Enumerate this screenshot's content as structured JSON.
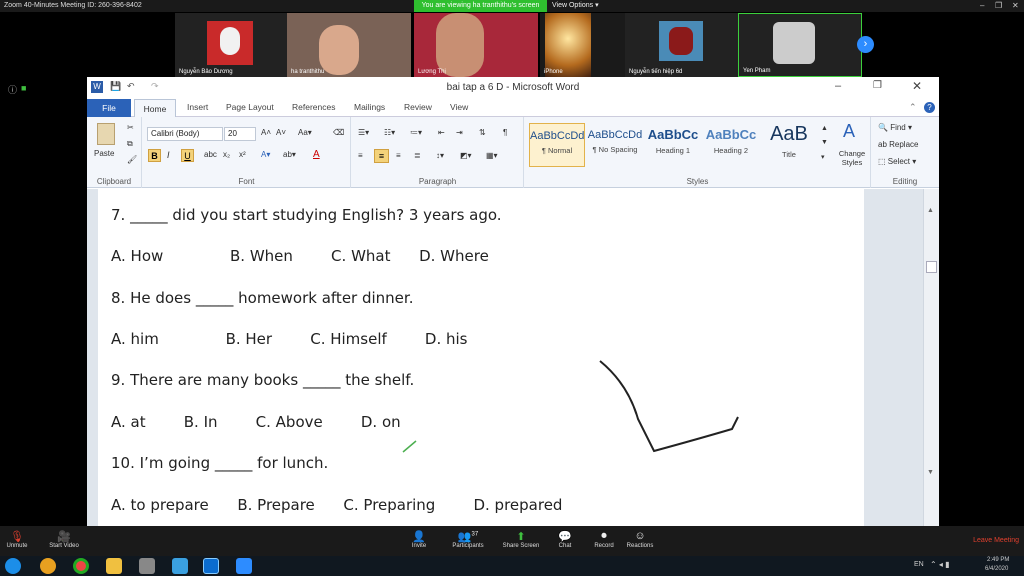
{
  "zoom": {
    "meeting_title": "Zoom 40-Minutes Meeting ID: 260-396-8402",
    "viewing_banner": "You are viewing ha tranthithu's screen",
    "view_options": "View Options",
    "participants": [
      {
        "name": "Nguyễn Bảo Dương"
      },
      {
        "name": "ha tranthithu"
      },
      {
        "name": "Lương Thị"
      },
      {
        "name": "iPhone"
      },
      {
        "name": "Nguyễn tiến hiệp 6d"
      },
      {
        "name": "Yen Pham"
      }
    ],
    "toolbar": {
      "unmute": "Unmute",
      "start_video": "Start Video",
      "invite": "Invite",
      "participants": "Participants",
      "participants_count": "37",
      "share_screen": "Share Screen",
      "chat": "Chat",
      "record": "Record",
      "reactions": "Reactions",
      "leave": "Leave Meeting"
    }
  },
  "word": {
    "title": "bai tap a 6 D - Microsoft Word",
    "tabs": [
      "File",
      "Home",
      "Insert",
      "Page Layout",
      "References",
      "Mailings",
      "Review",
      "View"
    ],
    "font_name": "Calibri (Body)",
    "font_size": "20",
    "groups": {
      "clipboard": "Clipboard",
      "font": "Font",
      "paragraph": "Paragraph",
      "styles": "Styles",
      "editing": "Editing"
    },
    "paste": "Paste",
    "styles": [
      {
        "sample": "AaBbCcDd",
        "label": "¶ Normal"
      },
      {
        "sample": "AaBbCcDd",
        "label": "¶ No Spacing"
      },
      {
        "sample": "AaBbCc",
        "label": "Heading 1"
      },
      {
        "sample": "AaBbCc",
        "label": "Heading 2"
      },
      {
        "sample": "AaB",
        "label": "Title"
      }
    ],
    "change_styles": "Change Styles",
    "editing": {
      "find": "Find",
      "replace": "Replace",
      "select": "Select"
    },
    "document_lines": [
      "7. _____ did you start studying English? 3 years ago.",
      "A. How              B. When        C. What      D. Where",
      "8. He does _____ homework after dinner.",
      "A. him              B. Her        C. Himself        D. his",
      "9. There are many books _____ the shelf.",
      "A. at        B. In        C. Above        D. on",
      "10. I’m going _____ for lunch.",
      "A. to prepare      B. Prepare      C. Preparing        D. prepared"
    ]
  },
  "taskbar": {
    "language": "EN",
    "time": "2:49 PM",
    "date": "6/4/2020"
  }
}
